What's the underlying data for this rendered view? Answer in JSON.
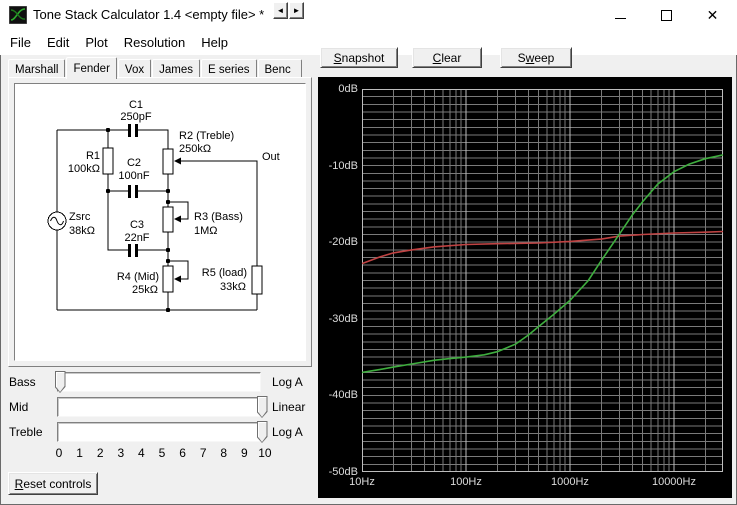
{
  "window": {
    "title": "Tone Stack Calculator 1.4 <empty file> *"
  },
  "menu": {
    "items": [
      "File",
      "Edit",
      "Plot",
      "Resolution",
      "Help"
    ]
  },
  "tabs": {
    "items": [
      "Marshall",
      "Fender",
      "Vox",
      "James",
      "E series",
      "Benc"
    ],
    "active": "Fender",
    "scroll_left_glyph": "◄",
    "scroll_right_glyph": "►"
  },
  "circuit": {
    "source_name": "Zsrc",
    "source_value": "38kΩ",
    "c1_ref": "C1",
    "c1_val": "250pF",
    "r1_ref": "R1",
    "r1_val": "100kΩ",
    "r2_ref": "R2 (Treble)",
    "r2_val": "250kΩ",
    "c2_ref": "C2",
    "c2_val": "100nF",
    "c3_ref": "C3",
    "c3_val": "22nF",
    "r3_ref": "R3 (Bass)",
    "r3_val": "1MΩ",
    "r4_ref": "R4 (Mid)",
    "r4_val": "25kΩ",
    "r5_ref": "R5 (load)",
    "r5_val": "33kΩ",
    "out_label": "Out"
  },
  "sliders": {
    "rows": [
      {
        "label": "Bass",
        "taper": "Log A",
        "value": 0
      },
      {
        "label": "Mid",
        "taper": "Linear",
        "value": 10
      },
      {
        "label": "Treble",
        "taper": "Log A",
        "value": 10
      }
    ],
    "scale": [
      "0",
      "1",
      "2",
      "3",
      "4",
      "5",
      "6",
      "7",
      "8",
      "9",
      "10"
    ],
    "min": 0,
    "max": 10
  },
  "buttons": {
    "snapshot": {
      "pre": "",
      "u": "S",
      "post": "napshot"
    },
    "clear": {
      "pre": "",
      "u": "C",
      "post": "lear"
    },
    "sweep": {
      "pre": "S",
      "u": "w",
      "post": "eep"
    },
    "reset": {
      "pre": "",
      "u": "R",
      "post": "eset controls"
    }
  },
  "colors": {
    "plot_bg": "#000000",
    "grid_minor": "#7a7a7a",
    "grid_major": "#bdbdbd",
    "plot_label": "#dcdcdc",
    "curve_current": "#3fae3f",
    "curve_snapshot": "#c04343"
  },
  "chart_data": {
    "type": "line",
    "x_scale": "log",
    "xlim": [
      10,
      29600
    ],
    "ylim": [
      -50,
      0
    ],
    "grid_db_step": 1,
    "x_ticks": [
      {
        "f": 10,
        "label": "10Hz"
      },
      {
        "f": 100,
        "label": "100Hz"
      },
      {
        "f": 1000,
        "label": "1000Hz"
      },
      {
        "f": 10000,
        "label": "10000Hz"
      }
    ],
    "y_ticks": [
      {
        "db": 0,
        "label": "0dB"
      },
      {
        "db": -10,
        "label": "-10dB"
      },
      {
        "db": -20,
        "label": "-20dB"
      },
      {
        "db": -30,
        "label": "-30dB"
      },
      {
        "db": -40,
        "label": "-40dB"
      },
      {
        "db": -50,
        "label": "-50dB"
      }
    ],
    "series": [
      {
        "name": "snapshot",
        "color": "#c04343",
        "points": [
          [
            10,
            -22.8
          ],
          [
            15,
            -21.9
          ],
          [
            20,
            -21.4
          ],
          [
            30,
            -21.0
          ],
          [
            50,
            -20.6
          ],
          [
            100,
            -20.3
          ],
          [
            200,
            -20.2
          ],
          [
            500,
            -20.1
          ],
          [
            1000,
            -19.9
          ],
          [
            2000,
            -19.6
          ],
          [
            3000,
            -19.2
          ],
          [
            5000,
            -19.0
          ],
          [
            10000,
            -18.8
          ],
          [
            20000,
            -18.7
          ],
          [
            29600,
            -18.6
          ]
        ]
      },
      {
        "name": "current",
        "color": "#3fae3f",
        "points": [
          [
            10,
            -37.0
          ],
          [
            15,
            -36.6
          ],
          [
            20,
            -36.3
          ],
          [
            30,
            -35.9
          ],
          [
            50,
            -35.4
          ],
          [
            70,
            -35.2
          ],
          [
            100,
            -35.0
          ],
          [
            150,
            -34.7
          ],
          [
            200,
            -34.3
          ],
          [
            300,
            -33.3
          ],
          [
            400,
            -32.1
          ],
          [
            500,
            -31.0
          ],
          [
            700,
            -29.4
          ],
          [
            1000,
            -27.6
          ],
          [
            1500,
            -25.0
          ],
          [
            2000,
            -22.4
          ],
          [
            3000,
            -18.9
          ],
          [
            4000,
            -16.4
          ],
          [
            5000,
            -14.7
          ],
          [
            7000,
            -12.4
          ],
          [
            10000,
            -10.8
          ],
          [
            14000,
            -9.8
          ],
          [
            20000,
            -9.1
          ],
          [
            29600,
            -8.6
          ]
        ]
      }
    ]
  }
}
